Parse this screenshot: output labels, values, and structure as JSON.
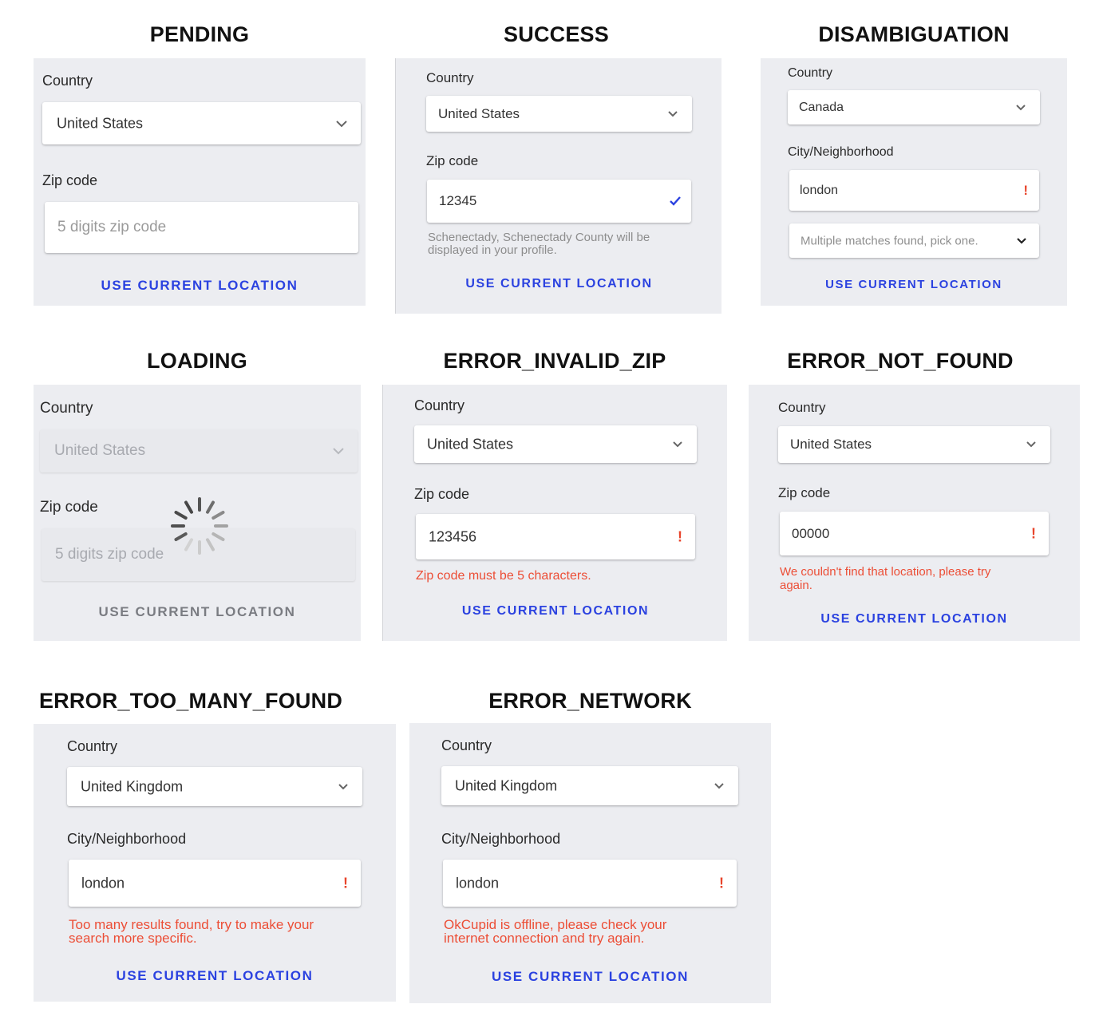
{
  "use_location_label": "USE CURRENT LOCATION",
  "colors": {
    "panel_bg": "#ecedf1",
    "link_blue": "#2b42e0",
    "error_red": "#ec4e36",
    "check_blue": "#2b42e0"
  },
  "icons": {
    "dropdown": "chevron-down-icon",
    "error": "exclamation-icon",
    "valid": "checkmark-icon",
    "loading": "spinner-icon"
  },
  "states": {
    "pending": {
      "heading": "PENDING",
      "country_label": "Country",
      "country_value": "United States",
      "field_label": "Zip code",
      "field_placeholder": "5 digits zip code"
    },
    "success": {
      "heading": "SUCCESS",
      "country_label": "Country",
      "country_value": "United States",
      "field_label": "Zip code",
      "field_value": "12345",
      "hint_line1": "Schenectady, Schenectady County will be",
      "hint_line2": "displayed in your profile."
    },
    "disambiguation": {
      "heading": "DISAMBIGUATION",
      "country_label": "Country",
      "country_value": "Canada",
      "field_label": "City/Neighborhood",
      "field_value": "london",
      "matches_value": "Multiple matches found, pick one."
    },
    "loading": {
      "heading": "LOADING",
      "country_label": "Country",
      "country_value": "United States",
      "field_label": "Zip code",
      "field_placeholder": "5 digits zip code"
    },
    "error_invalid_zip": {
      "heading": "ERROR_INVALID_ZIP",
      "country_label": "Country",
      "country_value": "United States",
      "field_label": "Zip code",
      "field_value": "123456",
      "error_text": "Zip code must be 5 characters."
    },
    "error_not_found": {
      "heading": "ERROR_NOT_FOUND",
      "country_label": "Country",
      "country_value": "United States",
      "field_label": "Zip code",
      "field_value": "00000",
      "error_line1": "We couldn't find that location, please try",
      "error_line2": "again."
    },
    "error_too_many_found": {
      "heading": "ERROR_TOO_MANY_FOUND",
      "country_label": "Country",
      "country_value": "United Kingdom",
      "field_label": "City/Neighborhood",
      "field_value": "london",
      "error_line1": "Too many results found, try to make your",
      "error_line2": "search more specific."
    },
    "error_network": {
      "heading": "ERROR_NETWORK",
      "country_label": "Country",
      "country_value": "United Kingdom",
      "field_label": "City/Neighborhood",
      "field_value": "london",
      "error_line1": "OkCupid is offline, please check your",
      "error_line2": "internet connection and try again."
    }
  }
}
